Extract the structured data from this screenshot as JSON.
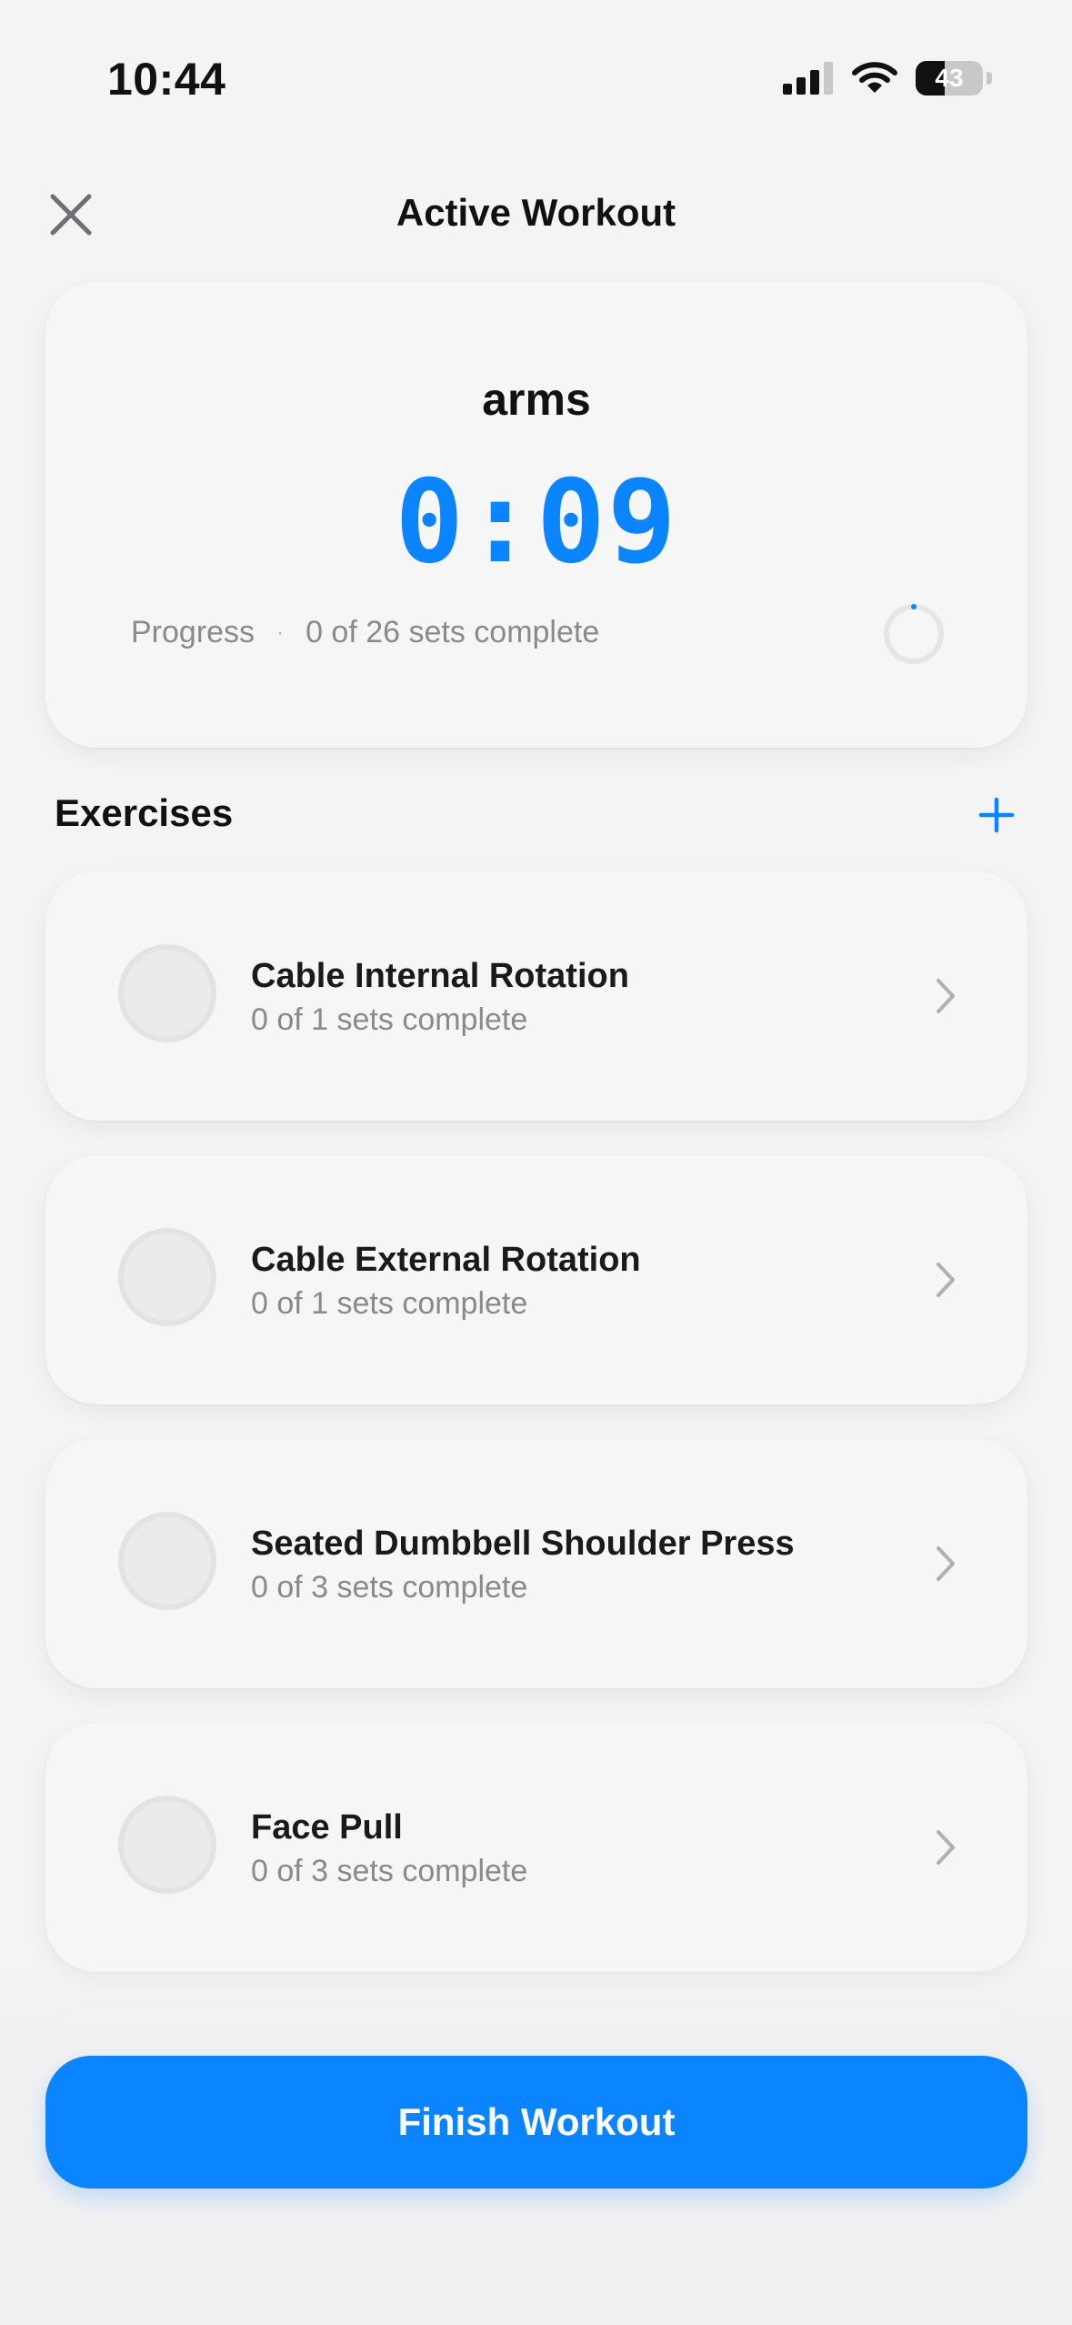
{
  "status_bar": {
    "time": "10:44",
    "battery_percent": "43",
    "battery_level": 0.43
  },
  "header": {
    "title": "Active Workout",
    "close_icon": "close-icon"
  },
  "summary": {
    "workout_name": "arms",
    "timer": "0:09",
    "progress_label": "Progress",
    "progress_separator": "·",
    "progress_text": "0 of 26 sets complete",
    "progress_fraction": 0
  },
  "exercises_section": {
    "title": "Exercises",
    "add_icon": "plus-icon"
  },
  "exercises": [
    {
      "name": "Cable Internal Rotation",
      "status": "0 of 1 sets complete"
    },
    {
      "name": "Cable External Rotation",
      "status": "0 of 1 sets complete"
    },
    {
      "name": "Seated Dumbbell Shoulder Press",
      "status": "0 of 3 sets complete"
    },
    {
      "name": "Face Pull",
      "status": "0 of 3 sets complete"
    }
  ],
  "finish_button": {
    "label": "Finish Workout"
  },
  "colors": {
    "accent": "#0a84ff",
    "background": "#f4f4f5",
    "card": "#f6f6f7",
    "secondary_text": "#8a8a8e"
  }
}
